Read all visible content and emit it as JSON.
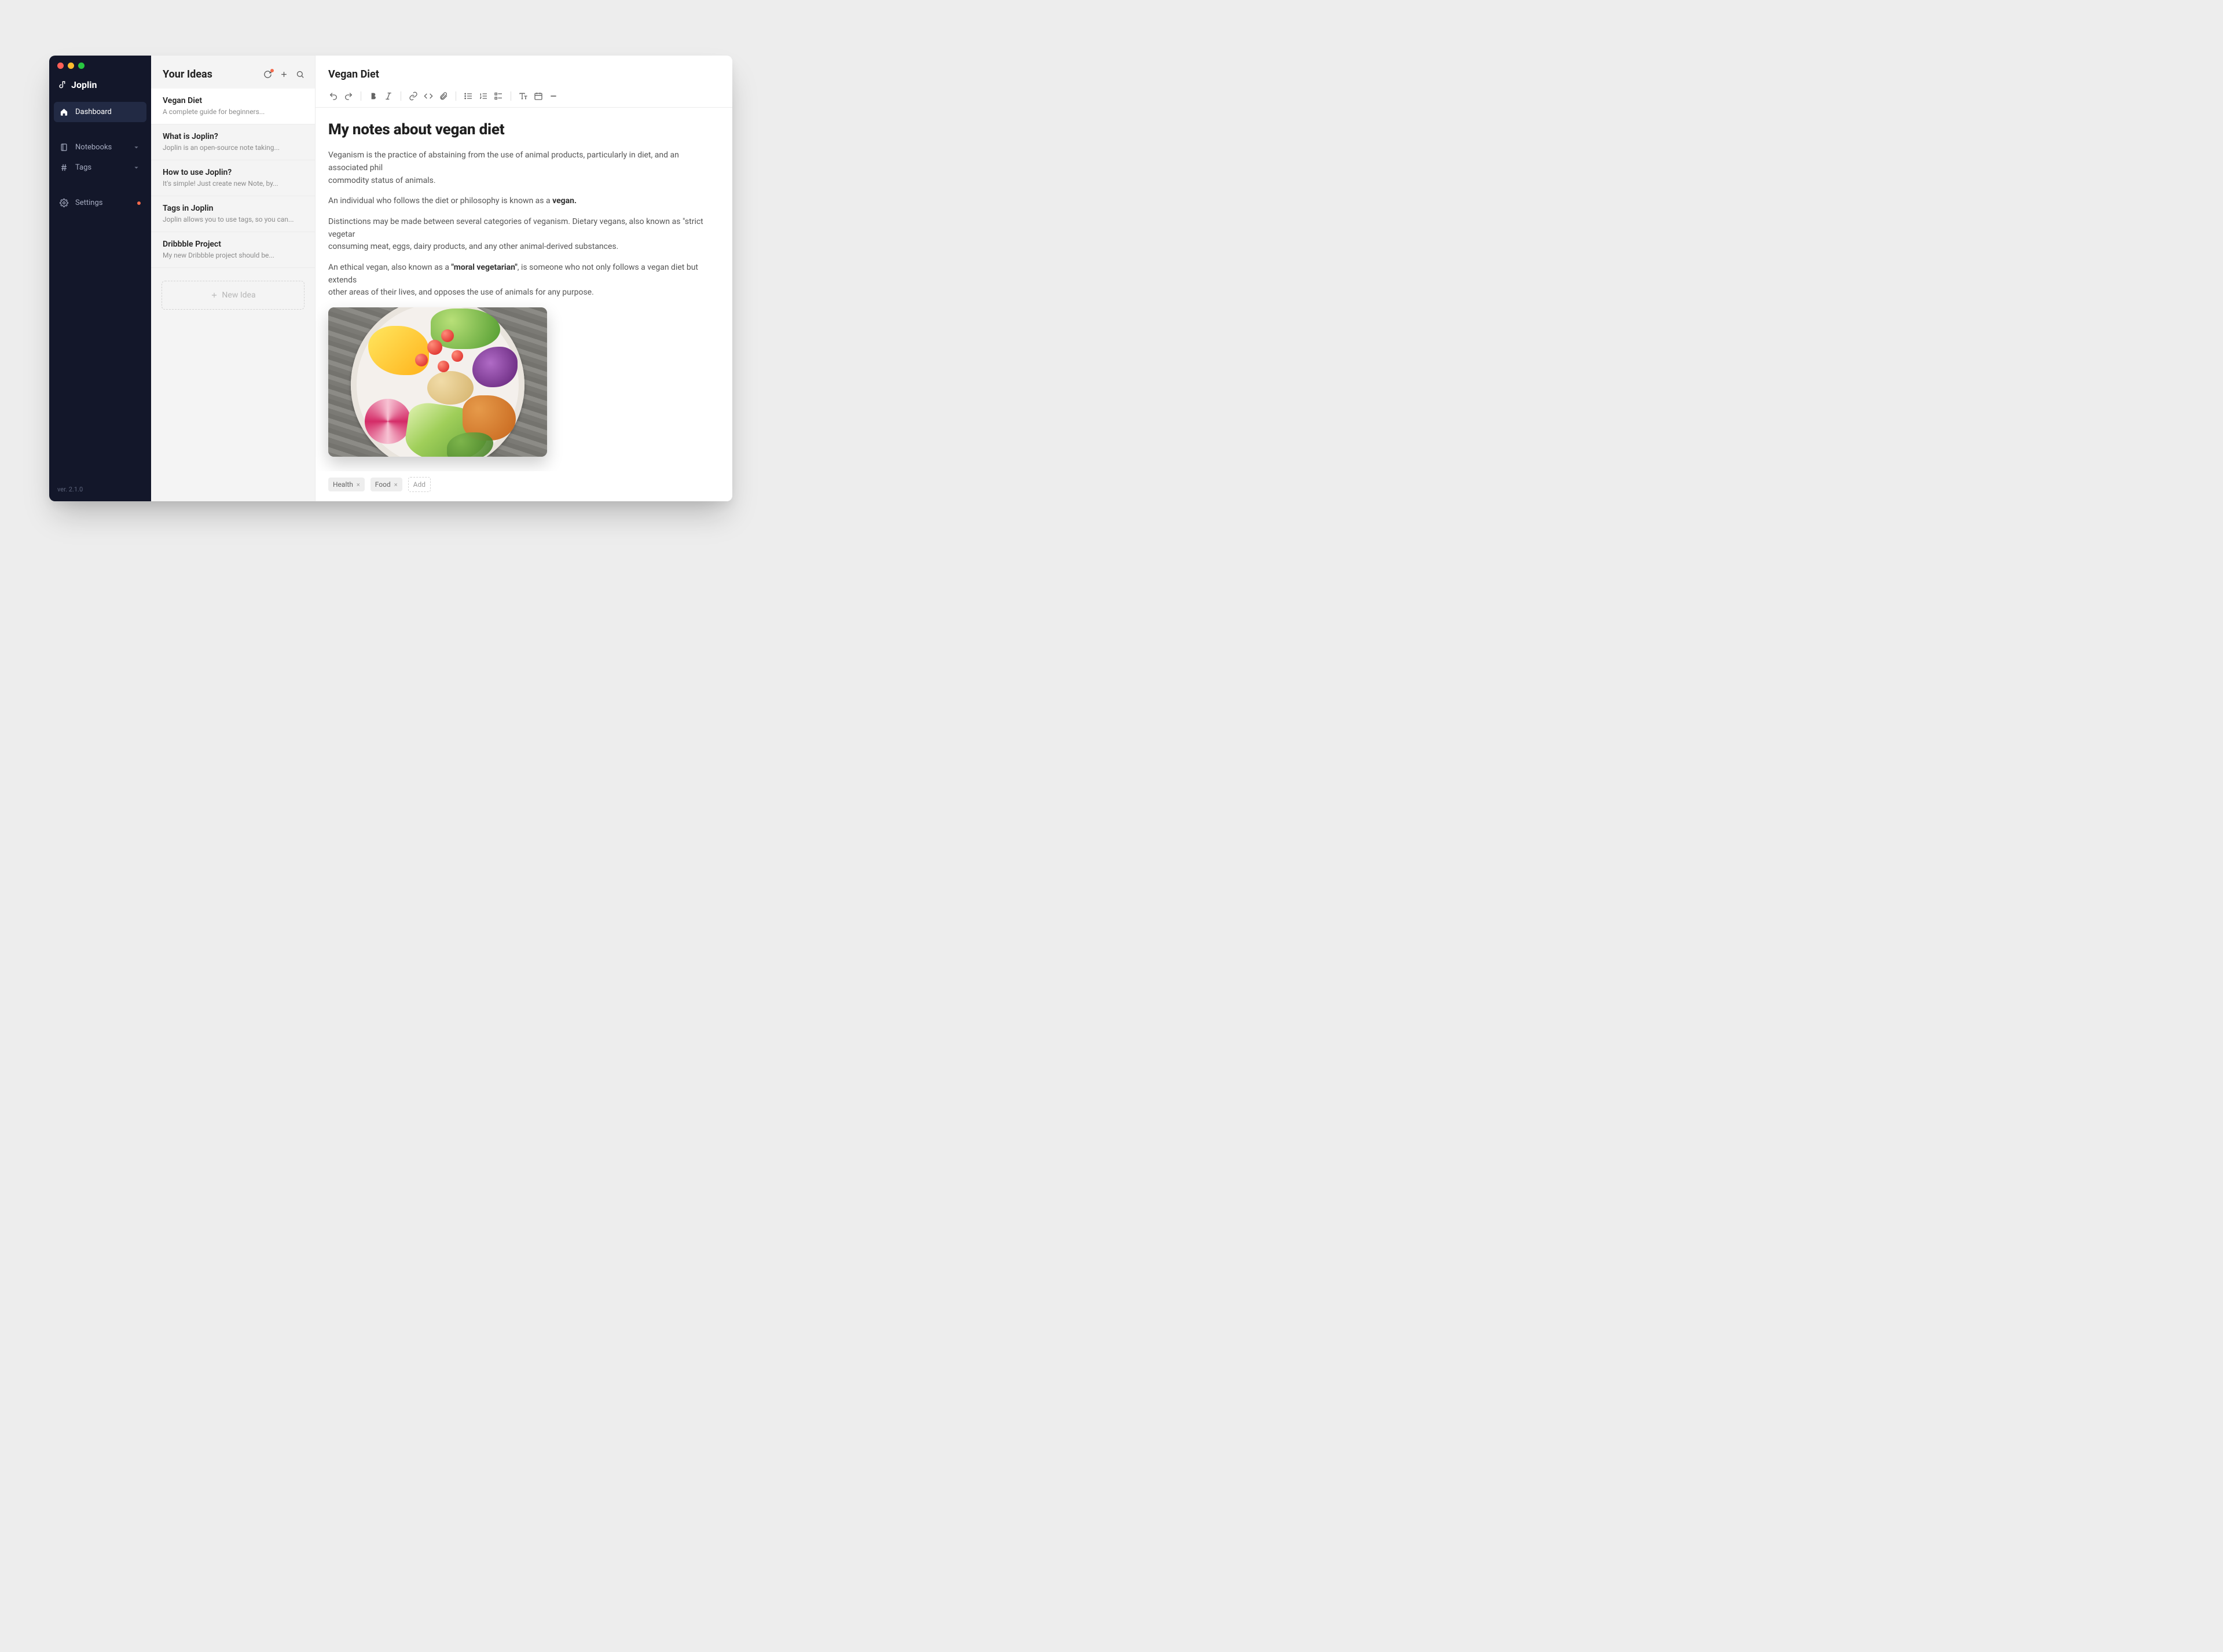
{
  "app": {
    "name": "Joplin",
    "version": "ver. 2.1.0"
  },
  "sidebar": {
    "items": [
      {
        "label": "Dashboard"
      },
      {
        "label": "Notebooks"
      },
      {
        "label": "Tags"
      },
      {
        "label": "Settings"
      }
    ]
  },
  "notes": {
    "header": "Your Ideas",
    "new_idea": "New Idea",
    "items": [
      {
        "title": "Vegan Diet",
        "excerpt": "A complete guide for beginners..."
      },
      {
        "title": "What is Joplin?",
        "excerpt": "Joplin is an open-source note taking..."
      },
      {
        "title": "How to use Joplin?",
        "excerpt": "It's simple! Just create new Note, by..."
      },
      {
        "title": "Tags in Joplin",
        "excerpt": "Joplin allows you to use tags, so you can..."
      },
      {
        "title": "Dribbble Project",
        "excerpt": "My new Dribbble project should be..."
      }
    ]
  },
  "editor": {
    "title": "Vegan Diet",
    "heading": "My notes about vegan diet",
    "p1a": "Veganism is the practice of abstaining from the use of animal products, particularly in diet, and an associated phil",
    "p1b": "commodity status of animals.",
    "p2a": "An individual who follows the diet or philosophy is known as a ",
    "p2b": "vegan.",
    "p3a": "Distinctions may be made between several categories of veganism. Dietary vegans, also known as \"strict vegetar",
    "p3b": "consuming meat, eggs, dairy products, and any other animal-derived substances.",
    "p4a": "An ethical vegan, also known as a ",
    "p4b": "\"moral vegetarian\"",
    "p4c": ", is someone who not only follows a vegan diet but extends",
    "p4d": "other areas of their lives, and opposes the use of animals for any purpose.",
    "tags": [
      {
        "label": "Health"
      },
      {
        "label": "Food"
      }
    ],
    "add_tag": "Add"
  }
}
